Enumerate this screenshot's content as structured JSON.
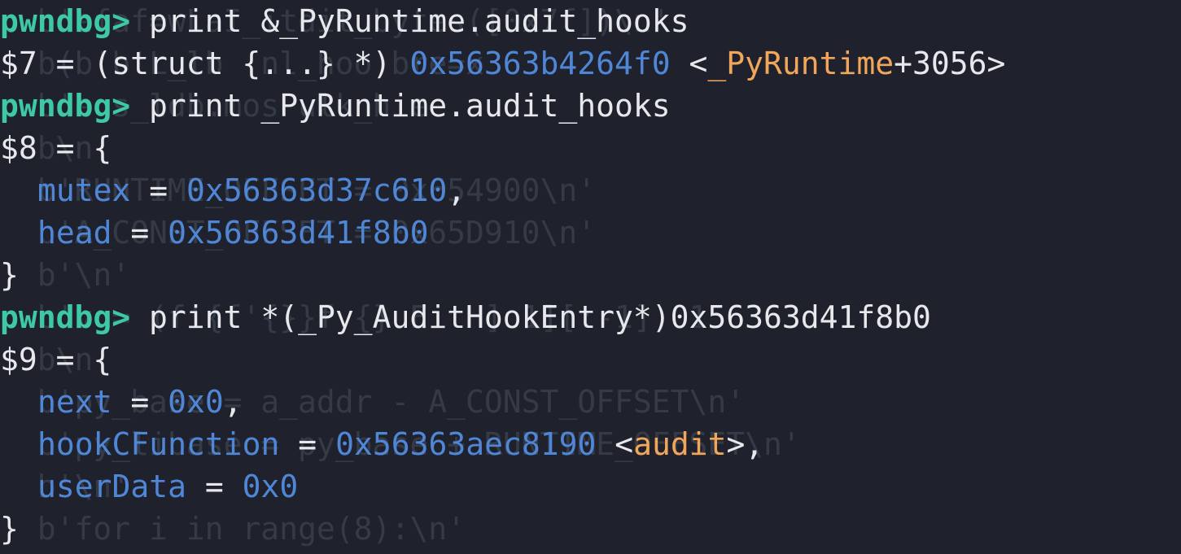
{
  "ghost": [
    "  b'afaf=wLaI_itdit_bytes([0x7f])\\n'",
    "  b(b'b'L_lb  nl_hoo bre=x",
    "  b'e s_ldb.mos ulk_hie",
    "  b\\n'",
    "  b'RUNTIME_OFFSET = 0x654900\\n'",
    "  b'A_CONST_OFFSET = 0x65D910\\n'",
    "  b'\\n'",
    "  b'v = (f'{f'{}}f {} E   ] 1][:-1], 1",
    "  b\\n'",
    "  b'py_base = a_addr - A_CONST_OFFSET\\n'",
    "  b'py_libase = py_base + RUNTIME_OFFSET\\n'",
    "  b'\\n'",
    "  b'for i in range(8):\\n'"
  ],
  "lines": [
    {
      "kind": "prompt",
      "prompt": "pwndbg>",
      "command": "print &_PyRuntime.audit_hooks"
    },
    {
      "kind": "result_ptr",
      "prefix": "$7 = (struct {...} *) ",
      "addr": "0x56363b4264f0",
      "open": " <",
      "symbol": "_PyRuntime",
      "close": "+3056>"
    },
    {
      "kind": "prompt",
      "prompt": "pwndbg>",
      "command": "print _PyRuntime.audit_hooks"
    },
    {
      "kind": "plain",
      "text": "$8 = {"
    },
    {
      "kind": "field",
      "name": "mutex",
      "sep": " = ",
      "value": "0x56363d37c610",
      "suffix": ","
    },
    {
      "kind": "field",
      "name": "head",
      "sep": " = ",
      "value": "0x56363d41f8b0",
      "suffix": ""
    },
    {
      "kind": "plain",
      "text": "}"
    },
    {
      "kind": "prompt",
      "prompt": "pwndbg>",
      "command": "print *(_Py_AuditHookEntry*)0x56363d41f8b0"
    },
    {
      "kind": "plain",
      "text": "$9 = {"
    },
    {
      "kind": "field",
      "name": "next",
      "sep": " = ",
      "value": "0x0",
      "suffix": ","
    },
    {
      "kind": "field_sym",
      "name": "hookCFunction",
      "sep": " = ",
      "value": "0x56363aec8190",
      "open": " <",
      "symbol": "audit",
      "close": ">,"
    },
    {
      "kind": "field",
      "name": "userData",
      "sep": " = ",
      "value": "0x0",
      "suffix": ""
    },
    {
      "kind": "plain",
      "text": "}"
    }
  ]
}
